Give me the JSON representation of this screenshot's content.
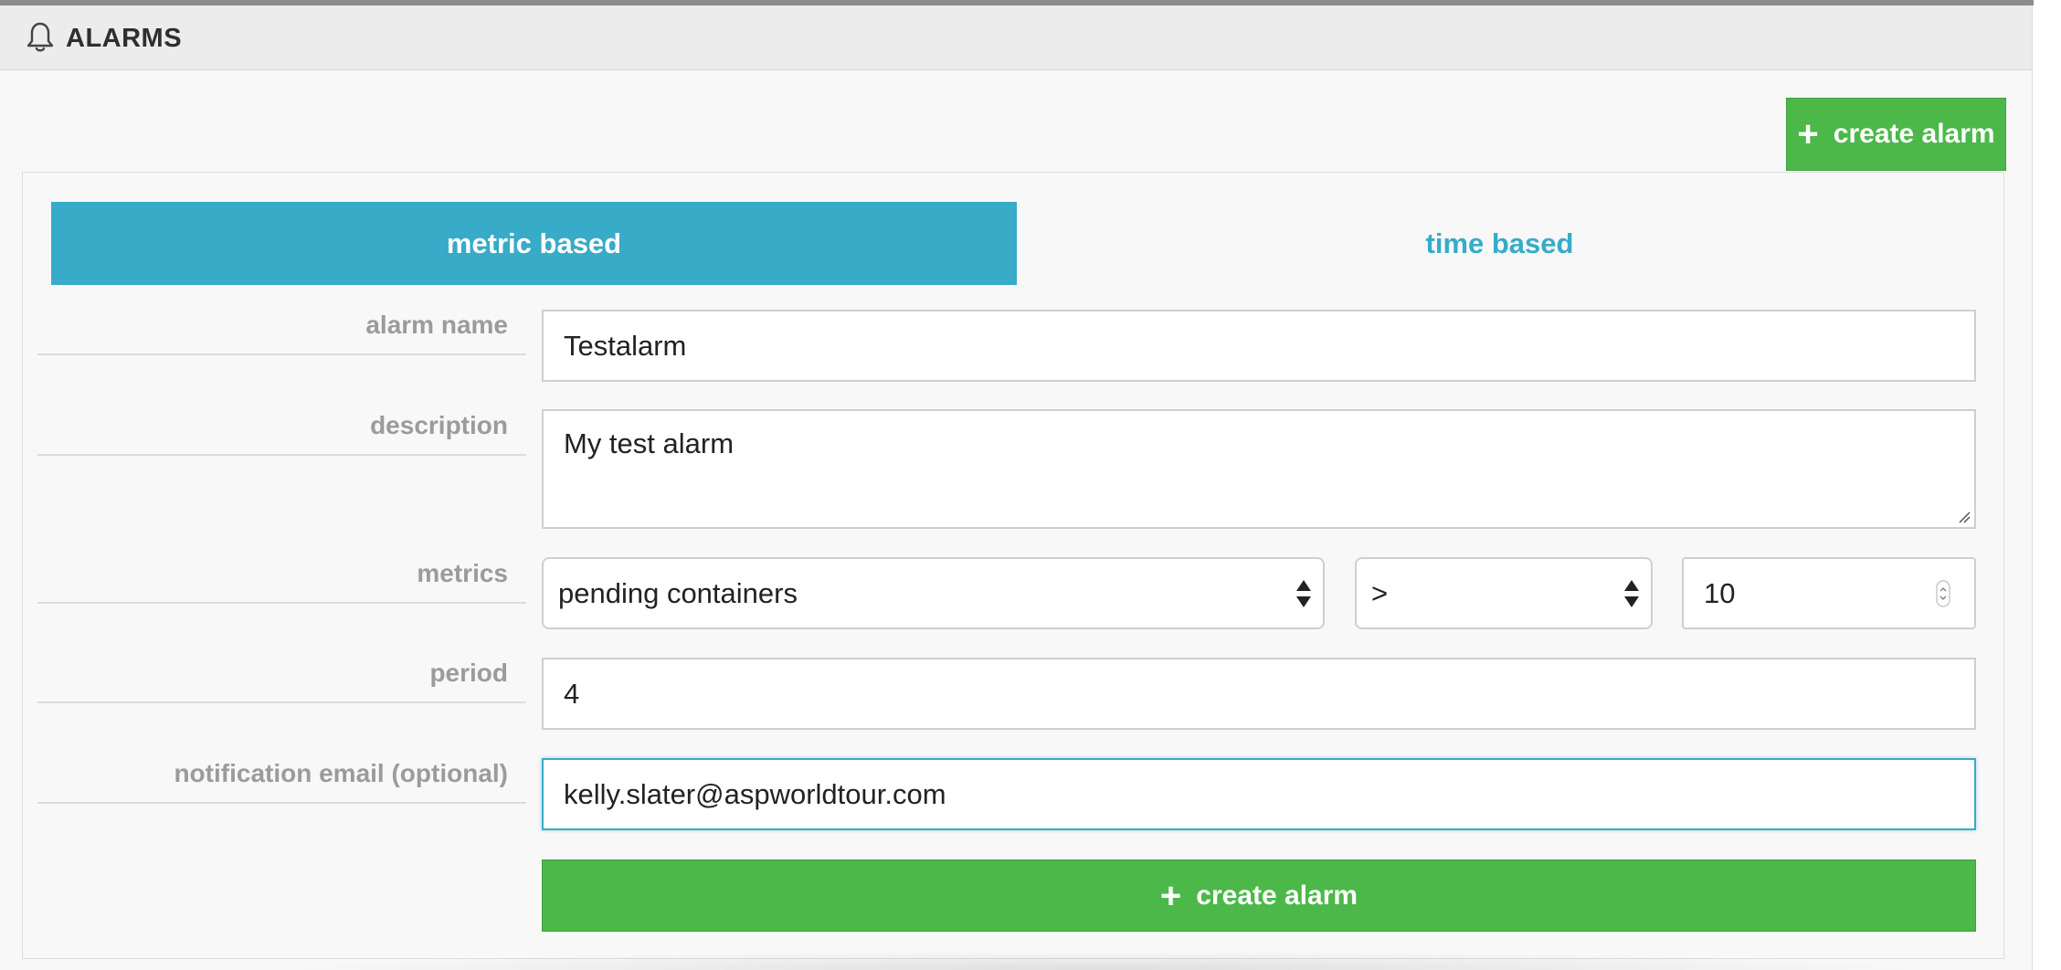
{
  "header": {
    "icon": "bell-icon",
    "title": "ALARMS"
  },
  "top_create": {
    "icon": "plus-icon",
    "label": "create alarm"
  },
  "tabs": [
    {
      "label": "metric based",
      "active": true
    },
    {
      "label": "time based",
      "active": false
    }
  ],
  "form": {
    "alarm_name": {
      "label": "alarm name",
      "value": "Testalarm"
    },
    "description": {
      "label": "description",
      "value": "My test alarm"
    },
    "metrics": {
      "label": "metrics",
      "metric": "pending containers",
      "operator": ">",
      "threshold": "10"
    },
    "period": {
      "label": "period",
      "value": "4"
    },
    "email": {
      "label": "notification email (optional)",
      "value": "kelly.slater@aspworldtour.com"
    }
  },
  "bottom_create": {
    "icon": "plus-icon",
    "label": "create alarm"
  },
  "colors": {
    "accent": "#37abc8",
    "success": "#4cb84a",
    "label_gray": "#9b9b9b"
  }
}
